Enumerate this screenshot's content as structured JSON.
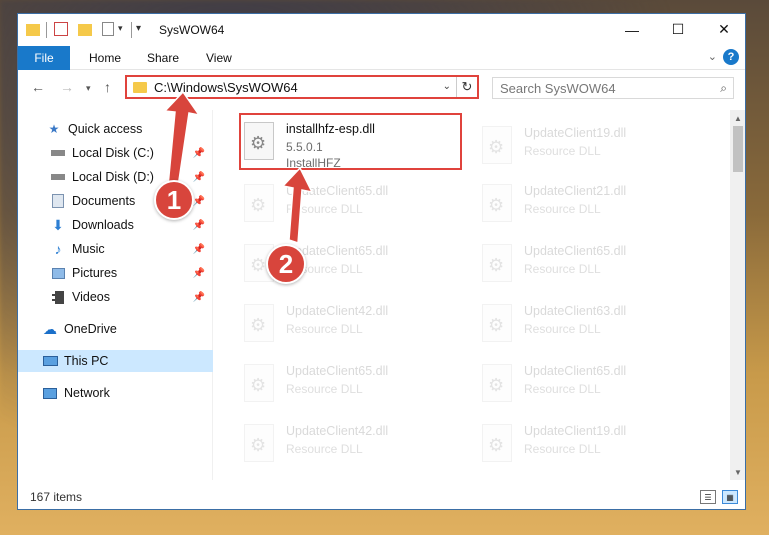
{
  "window": {
    "title": "SysWOW64"
  },
  "ribbon": {
    "tabs": [
      "File",
      "Home",
      "Share",
      "View"
    ]
  },
  "nav": {
    "address_path": "C:\\Windows\\SysWOW64",
    "search_placeholder": "Search SysWOW64"
  },
  "sidebar": {
    "items": [
      {
        "label": "Quick access",
        "icon": "star-icon",
        "pinned": false
      },
      {
        "label": "Local Disk (C:)",
        "icon": "drive-icon",
        "pinned": true
      },
      {
        "label": "Local Disk (D:)",
        "icon": "drive-icon",
        "pinned": true
      },
      {
        "label": "Documents",
        "icon": "documents-icon",
        "pinned": true
      },
      {
        "label": "Downloads",
        "icon": "download-icon",
        "pinned": true
      },
      {
        "label": "Music",
        "icon": "music-icon",
        "pinned": true
      },
      {
        "label": "Pictures",
        "icon": "pictures-icon",
        "pinned": true
      },
      {
        "label": "Videos",
        "icon": "videos-icon",
        "pinned": true
      },
      {
        "label": "OneDrive",
        "icon": "onedrive-icon",
        "pinned": false
      },
      {
        "label": "This PC",
        "icon": "pc-icon",
        "pinned": false,
        "selected": true
      },
      {
        "label": "Network",
        "icon": "network-icon",
        "pinned": false
      }
    ]
  },
  "files": {
    "highlighted": {
      "name": "installhfz-esp.dll",
      "line2": "5.5.0.1",
      "line3": "InstallHFZ"
    },
    "left_column": [
      {
        "name": "UpdateClient65.dll",
        "line2": "Resource DLL"
      },
      {
        "name": "UpdateClient65.dll",
        "line2": "Resource DLL"
      },
      {
        "name": "UpdateClient42.dll",
        "line2": "Resource DLL"
      },
      {
        "name": "UpdateClient65.dll",
        "line2": "Resource DLL"
      },
      {
        "name": "UpdateClient42.dll",
        "line2": "Resource DLL"
      }
    ],
    "right_column": [
      {
        "name": "UpdateClient19.dll",
        "line2": "Resource DLL"
      },
      {
        "name": "UpdateClient21.dll",
        "line2": "Resource DLL"
      },
      {
        "name": "UpdateClient65.dll",
        "line2": "Resource DLL"
      },
      {
        "name": "UpdateClient63.dll",
        "line2": "Resource DLL"
      },
      {
        "name": "UpdateClient65.dll",
        "line2": "Resource DLL"
      },
      {
        "name": "UpdateClient19.dll",
        "line2": "Resource DLL"
      }
    ]
  },
  "status": {
    "item_count": "167 items"
  },
  "annotations": {
    "step1": "1",
    "step2": "2",
    "color": "#d8453c"
  }
}
